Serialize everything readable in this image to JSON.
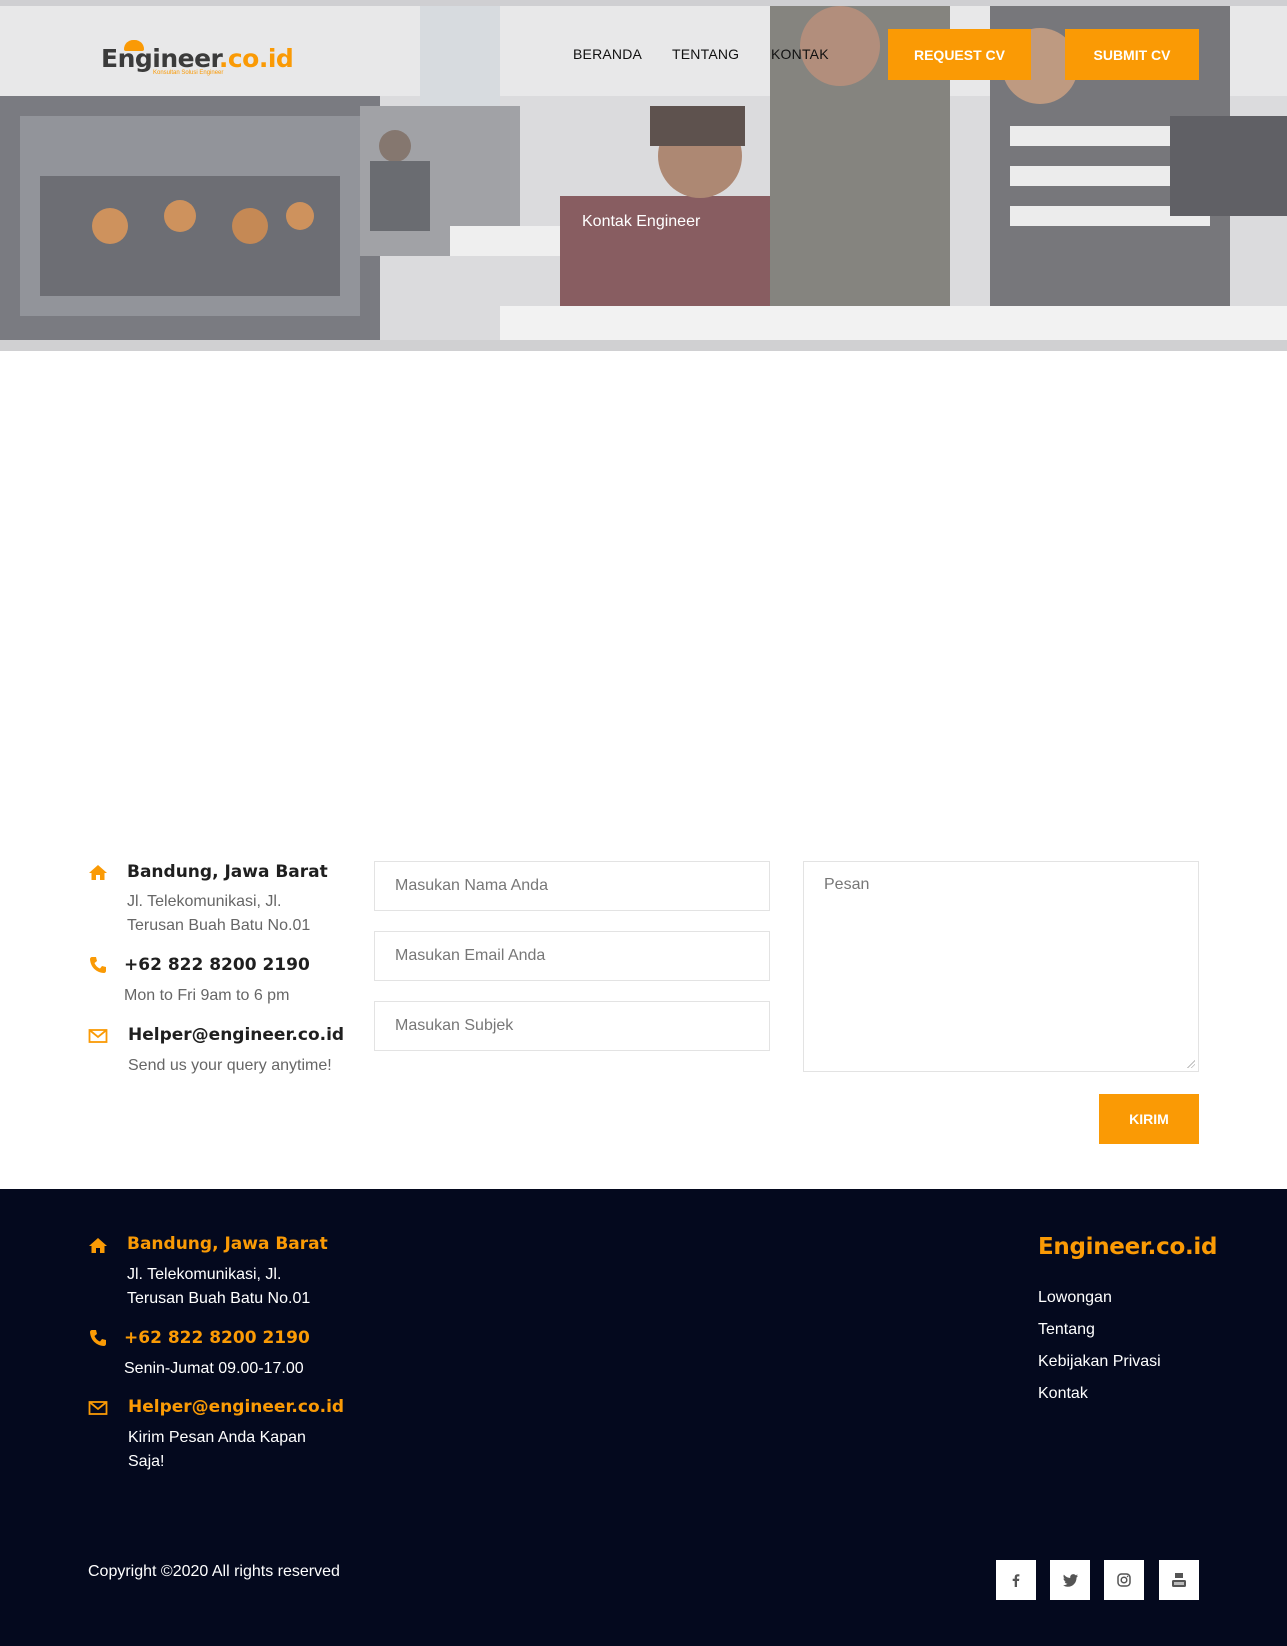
{
  "header": {
    "logo_text_main": "Engineer",
    "logo_text_domain": ".co.id",
    "logo_tagline": "Konsultan Solusi Engineer",
    "nav": [
      "BERANDA",
      "TENTANG",
      "KONTAK"
    ],
    "request_cv_label": "REQUEST CV",
    "submit_cv_label": "SUBMIT CV",
    "hero_title": "Kontak Engineer"
  },
  "contact_info": {
    "address_title": "Bandung, Jawa Barat",
    "address_line1": "Jl. Telekomunikasi, Jl.",
    "address_line2": "Terusan Buah Batu No.01",
    "phone_title": "+62 822 8200 2190",
    "phone_sub": "Mon to Fri 9am to 6 pm",
    "email_title": "Helper@engineer.co.id",
    "email_sub": "Send us your query anytime!"
  },
  "form": {
    "name_placeholder": "Masukan Nama Anda",
    "email_placeholder": "Masukan Email Anda",
    "subject_placeholder": "Masukan Subjek",
    "message_placeholder": "Pesan",
    "submit_label": "KIRIM"
  },
  "footer": {
    "address_title": "Bandung, Jawa Barat",
    "address_line1": "Jl. Telekomunikasi, Jl.",
    "address_line2": "Terusan Buah Batu No.01",
    "phone_title": "+62 822 8200 2190",
    "phone_sub": "Senin-Jumat 09.00-17.00",
    "email_title": "Helper@engineer.co.id",
    "email_sub_line1": "Kirim Pesan Anda Kapan",
    "email_sub_line2": "Saja!",
    "brand": "Engineer.co.id",
    "links": [
      "Lowongan",
      "Tentang",
      "Kebijakan Privasi",
      "Kontak"
    ],
    "copyright": "Copyright ©2020 All rights reserved",
    "social": [
      "facebook-icon",
      "twitter-icon",
      "instagram-icon",
      "youtube-icon"
    ]
  },
  "colors": {
    "accent": "#fa9a05",
    "footer_bg": "#04091e"
  }
}
